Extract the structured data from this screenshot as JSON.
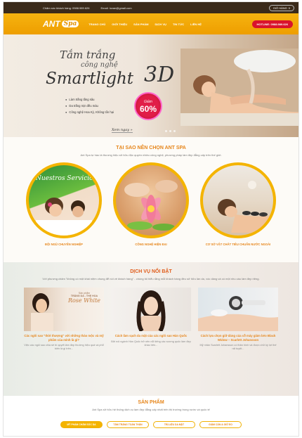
{
  "topbar": {
    "phone_label": "Chăm sóc khách hàng: 0988.989.626",
    "email_label": "Email: lovan@gmail.com",
    "cart_label": "GIỎ HÀNG",
    "cart_count": "0"
  },
  "nav": {
    "logo_text": "ANT",
    "logo_sub": "Spa",
    "menu": [
      "TRANG CHỦ",
      "GIỚI THIỆU",
      "SẢN PHẨM",
      "DỊCH VỤ",
      "TIN TỨC",
      "LIÊN HỆ"
    ],
    "hotline": "HOTLINE: 0988.989.626"
  },
  "banner": {
    "line1": "Tắm trắng",
    "line2": "công nghệ",
    "line3": "Smartlight",
    "line4": "3D",
    "features": [
      "Làm trắng tầng sâu",
      "Da trắng mịn đều màu",
      "Công nghệ Hoa Kỳ, Không tổn hại"
    ],
    "badge_small": "Giảm",
    "badge_big": "60%",
    "cta": "Xem ngay »"
  },
  "why": {
    "title": "TẠI SAO NÊN CHỌN ANT SPA",
    "subtitle": "Ant Spa tự hào là thương hiệu sở hữu độc quyền nhiều công nghệ, phương pháp làm đẹp đẳng cấp trên thế giới.",
    "items": [
      {
        "label": "ĐỘI NGŨ CHUYÊN NGHIỆP",
        "overlay": "Nuestros Servicios"
      },
      {
        "label": "CÔNG NGHỆ HIỆN ĐẠI"
      },
      {
        "label": "CƠ SỞ VẬT CHẤT TIÊU CHUẨN NƯỚC NGOÀI"
      }
    ]
  },
  "services": {
    "title": "DỊCH VỤ NỔI BẬT",
    "subtitle": "Với phương châm \"không có một khái niệm chung để nói về khách hàng\" - chúng tôi hiểu rằng mỗi khách hàng đều sở hữu làn da, vóc dáng và có một nhu cầu làm đẹp riêng.",
    "cards": [
      {
        "title": "Các ngôi sao \"thời thượng\" với những thảo mộc và mỹ phẩm của mình là gì?",
        "desc": "Việc các ngôi sao chia sẻ bí quyết làm đẹp thường hiệu quả và phổ biến là gì trên...",
        "img_text1": "Sản phẩm",
        "img_text2": "TRẮNG DA - THE HOA",
        "img_text3": "Rose White"
      },
      {
        "title": "Cách làm sạch da mặt của các ngôi sao Hàn Quốc",
        "desc": "Bởi nói ngành Hàn Quốc trở nên nổi tiếng các sương quốc làm đẹp khác trên..."
      },
      {
        "title": "Cách lựa chọn giữ dáng của cỗ máy giảm béo Black Widow – Scarlett Johansson",
        "desc": "Mỹ nhân Scarlett Johansson có thân hình và được chữ ký lợi thế rất tuyệt..."
      }
    ]
  },
  "products": {
    "title": "SẢN PHẨM",
    "subtitle": "Ant Spa sở hữu hệ thống dịch vụ làm đẹp đẳng cấp nhất trên thị trường trong nước và quốc tế",
    "tabs": [
      "MỸ PHẨM CHĂM SÓC DA",
      "TẮM TRẮNG TOÀN THÂN",
      "TRỊ LIỆU DA MẶT",
      "GIẢM CÂN & GIỮ EO"
    ],
    "active_tab": 0
  },
  "colors": {
    "accent": "#f4b400",
    "title": "#e6851a",
    "hotline": "#d9132c",
    "badge": "#e11d48"
  }
}
